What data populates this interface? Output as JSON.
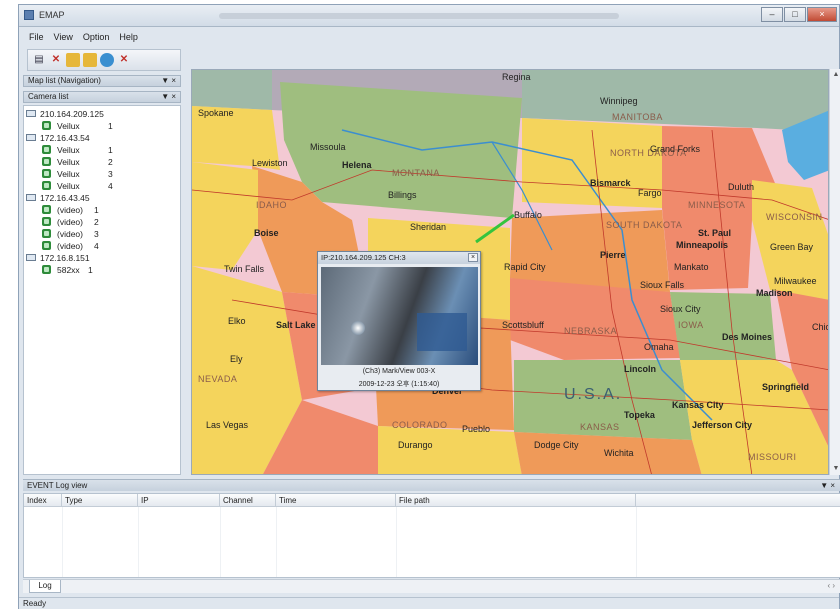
{
  "window": {
    "title": "EMAP"
  },
  "menu": [
    "File",
    "View",
    "Option",
    "Help"
  ],
  "panels": {
    "map_header": "Map list (Navigation)",
    "camera_header": "Camera list"
  },
  "tree": [
    {
      "kind": "host",
      "label": "210.164.209.125"
    },
    {
      "kind": "cam",
      "label": "Veilux",
      "ch": "1"
    },
    {
      "kind": "host",
      "label": "172.16.43.54"
    },
    {
      "kind": "cam",
      "label": "Veilux",
      "ch": "1"
    },
    {
      "kind": "cam",
      "label": "Veilux",
      "ch": "2"
    },
    {
      "kind": "cam",
      "label": "Veilux",
      "ch": "3"
    },
    {
      "kind": "cam",
      "label": "Veilux",
      "ch": "4"
    },
    {
      "kind": "host",
      "label": "172.16.43.45"
    },
    {
      "kind": "cam",
      "label": "(video)",
      "ch": "1"
    },
    {
      "kind": "cam",
      "label": "(video)",
      "ch": "2"
    },
    {
      "kind": "cam",
      "label": "(video)",
      "ch": "3"
    },
    {
      "kind": "cam",
      "label": "(video)",
      "ch": "4"
    },
    {
      "kind": "host",
      "label": "172.16.8.151"
    },
    {
      "kind": "cam",
      "label": "582xx",
      "ch": "1"
    }
  ],
  "map_labels": {
    "regina": "Regina",
    "winnipeg": "Winnipeg",
    "manitoba": "MANITOBA",
    "spokane": "Spokane",
    "north_dakota": "NORTH DAKOTA",
    "bismarck": "Bismarck",
    "fargo": "Fargo",
    "grand_forks": "Grand Forks",
    "helena": "Helena",
    "montana": "MONTANA",
    "missoula": "Missoula",
    "billings": "Billings",
    "idaho": "IDAHO",
    "boise": "Boise",
    "twin_falls": "Twin Falls",
    "lewiston": "Lewiston",
    "south_dakota": "SOUTH DAKOTA",
    "pierre": "Pierre",
    "rapid_city": "Rapid City",
    "sioux_falls": "Sioux Falls",
    "minnesota": "MINNESOTA",
    "st_paul": "St. Paul",
    "minneapolis": "Minneapolis",
    "duluth": "Duluth",
    "wisconsin": "WISCONSIN",
    "green_bay": "Green Bay",
    "milwaukee": "Milwaukee",
    "madison": "Madison",
    "nebraska": "NEBRASKA",
    "omaha": "Omaha",
    "lincoln": "Lincoln",
    "iowa": "IOWA",
    "des_moines": "Des Moines",
    "kansas": "KANSAS",
    "topeka": "Topeka",
    "wichita": "Wichita",
    "kansas_city": "Kansas City",
    "missouri": "MISSOURI",
    "jefferson_city": "Jefferson City",
    "springfield": "Springfield",
    "nevada": "NEVADA",
    "salt_lake": "Salt Lake",
    "colorado": "COLORADO",
    "denver": "Denver",
    "pueblo": "Pueblo",
    "las_vegas": "Las Vegas",
    "usa": "U.S.A.",
    "sheridan": "Sheridan",
    "buffalo": "Buffalo",
    "mankato": "Mankato",
    "sioux_city": "Sioux City",
    "scottsbluff": "Scottsbluff",
    "elko": "Elko",
    "ely": "Ely",
    "durango": "Durango",
    "dodge_city": "Dodge City",
    "chicago": "Chic"
  },
  "popup": {
    "title": "IP:210.164.209.125 CH:3",
    "close": "×",
    "line1": "(Ch3) Mark/View 003-X",
    "line2": "2009-12-23 오후 (1:15:40)"
  },
  "log": {
    "title": "EVENT Log view",
    "columns": [
      "Index",
      "Type",
      "IP",
      "Channel",
      "Time",
      "File path"
    ],
    "tab": "Log"
  },
  "status": "Ready"
}
